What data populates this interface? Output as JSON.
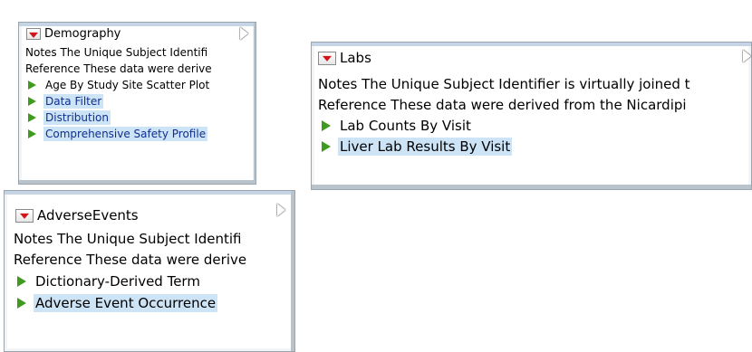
{
  "panels": {
    "demography": {
      "title": "Demography",
      "notes": "Notes  The Unique Subject Identifi",
      "reference": "Reference  These data were derive",
      "items": [
        {
          "label": "Age By Study Site Scatter Plot"
        },
        {
          "label": "Data Filter"
        },
        {
          "label": "Distribution"
        },
        {
          "label": "Comprehensive Safety Profile"
        }
      ]
    },
    "labs": {
      "title": "Labs",
      "notes": "Notes  The Unique Subject Identifier is virtually joined t",
      "reference": "Reference  These data were derived from the Nicardipi",
      "items": [
        {
          "label": "Lab Counts By Visit"
        },
        {
          "label": "Liver Lab Results By Visit"
        }
      ]
    },
    "adverse_events": {
      "title": "AdverseEvents",
      "notes": "Notes  The Unique Subject Identifi",
      "reference": "Reference  These data were derive",
      "items": [
        {
          "label": "Dictionary-Derived Term"
        },
        {
          "label": "Adverse Event Occurrence"
        }
      ]
    }
  },
  "colors": {
    "selection": "#cde3f6",
    "link_text": "#0f2f8f",
    "run_triangle": "#3f9b1f",
    "menu_arrow": "#d0141a"
  },
  "icons": [
    "red-menu-arrow-icon",
    "collapse-triangle-icon",
    "green-play-triangle-icon"
  ]
}
